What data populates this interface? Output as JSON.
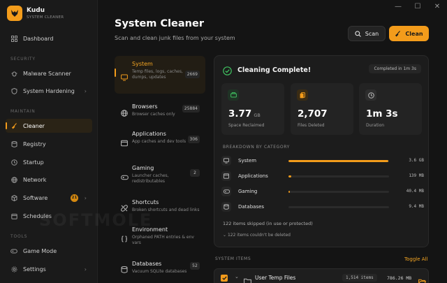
{
  "app": {
    "name": "Kudu",
    "subtitle": "SYSTEM CLEANER"
  },
  "window_controls": {
    "minimize": "—",
    "maximize": "☐",
    "close": "✕"
  },
  "sidebar": {
    "dashboard": "Dashboard",
    "sections": {
      "security": "SECURITY",
      "maintain": "MAINTAIN",
      "tools": "TOOLS"
    },
    "security_items": [
      {
        "label": "Malware Scanner",
        "icon": "bug-icon"
      },
      {
        "label": "System Hardening",
        "icon": "shield-icon"
      }
    ],
    "maintain_items": [
      {
        "label": "Cleaner",
        "icon": "broom-icon",
        "active": true
      },
      {
        "label": "Registry",
        "icon": "database-icon"
      },
      {
        "label": "Startup",
        "icon": "clock-icon"
      },
      {
        "label": "Network",
        "icon": "globe-icon"
      },
      {
        "label": "Software",
        "icon": "package-icon",
        "badge": "21"
      },
      {
        "label": "Schedules",
        "icon": "calendar-icon"
      }
    ],
    "tools_items": [
      {
        "label": "Game Mode",
        "icon": "gamepad-icon"
      },
      {
        "label": "Settings",
        "icon": "gear-icon"
      }
    ]
  },
  "header": {
    "title": "System Cleaner",
    "subtitle": "Scan and clean junk files from your system",
    "scan_label": "Scan",
    "clean_label": "Clean"
  },
  "categories": [
    {
      "name": "System",
      "desc": "Temp files, logs, caches, dumps, updates",
      "count": "2669",
      "icon": "monitor-icon",
      "active": true
    },
    {
      "name": "Browsers",
      "desc": "Browser caches only",
      "count": "25884",
      "icon": "globe-icon"
    },
    {
      "name": "Applications",
      "desc": "App caches and dev tools",
      "count": "306",
      "icon": "window-icon"
    },
    {
      "name": "Gaming",
      "desc": "Launcher caches, redistributables",
      "count": "2",
      "icon": "gamepad-icon"
    },
    {
      "name": "Shortcuts",
      "desc": "Broken shortcuts and dead links",
      "count": "",
      "icon": "broken-link-icon"
    },
    {
      "name": "Environment",
      "desc": "Orphaned PATH entries & env vars",
      "count": "",
      "icon": "braces-icon"
    },
    {
      "name": "Databases",
      "desc": "Vacuum SQLite databases",
      "count": "52",
      "icon": "database-icon"
    }
  ],
  "result": {
    "title": "Cleaning Complete!",
    "badge": "Completed in 1m 3s",
    "stats": [
      {
        "value": "3.77",
        "unit": "GB",
        "label": "Space Reclaimed",
        "icon": "drive-icon",
        "color": "#3fbf5f"
      },
      {
        "value": "2,707",
        "unit": "",
        "label": "Files Deleted",
        "icon": "files-icon",
        "color": "#f39c1b"
      },
      {
        "value": "1m 3s",
        "unit": "",
        "label": "Duration",
        "icon": "clock-icon",
        "color": "#9a9a9a"
      }
    ],
    "breakdown_label": "BREAKDOWN BY CATEGORY",
    "breakdown": [
      {
        "name": "System",
        "value": "3.6 GB",
        "fraction": 0.99,
        "icon": "monitor-icon"
      },
      {
        "name": "Applications",
        "value": "139 MB",
        "fraction": 0.03,
        "icon": "window-icon"
      },
      {
        "name": "Gaming",
        "value": "40.4 MB",
        "fraction": 0.01,
        "icon": "gamepad-icon"
      },
      {
        "name": "Databases",
        "value": "9.4 MB",
        "fraction": 0.0,
        "icon": "database-icon"
      }
    ],
    "skipped": "122 items skipped (in use or protected)",
    "not_deleted": "122 items couldn't be deleted"
  },
  "system_items": {
    "label": "SYSTEM ITEMS",
    "toggle_all": "Toggle All",
    "rows": [
      {
        "name": "User Temp Files",
        "count": "1,514 items",
        "size": "786.26 MB"
      }
    ]
  },
  "watermark": "SOFTMOLE",
  "colors": {
    "accent": "#f39c1b",
    "success": "#3fbf5f",
    "background": "#141414",
    "panel": "#1c1c1c"
  }
}
